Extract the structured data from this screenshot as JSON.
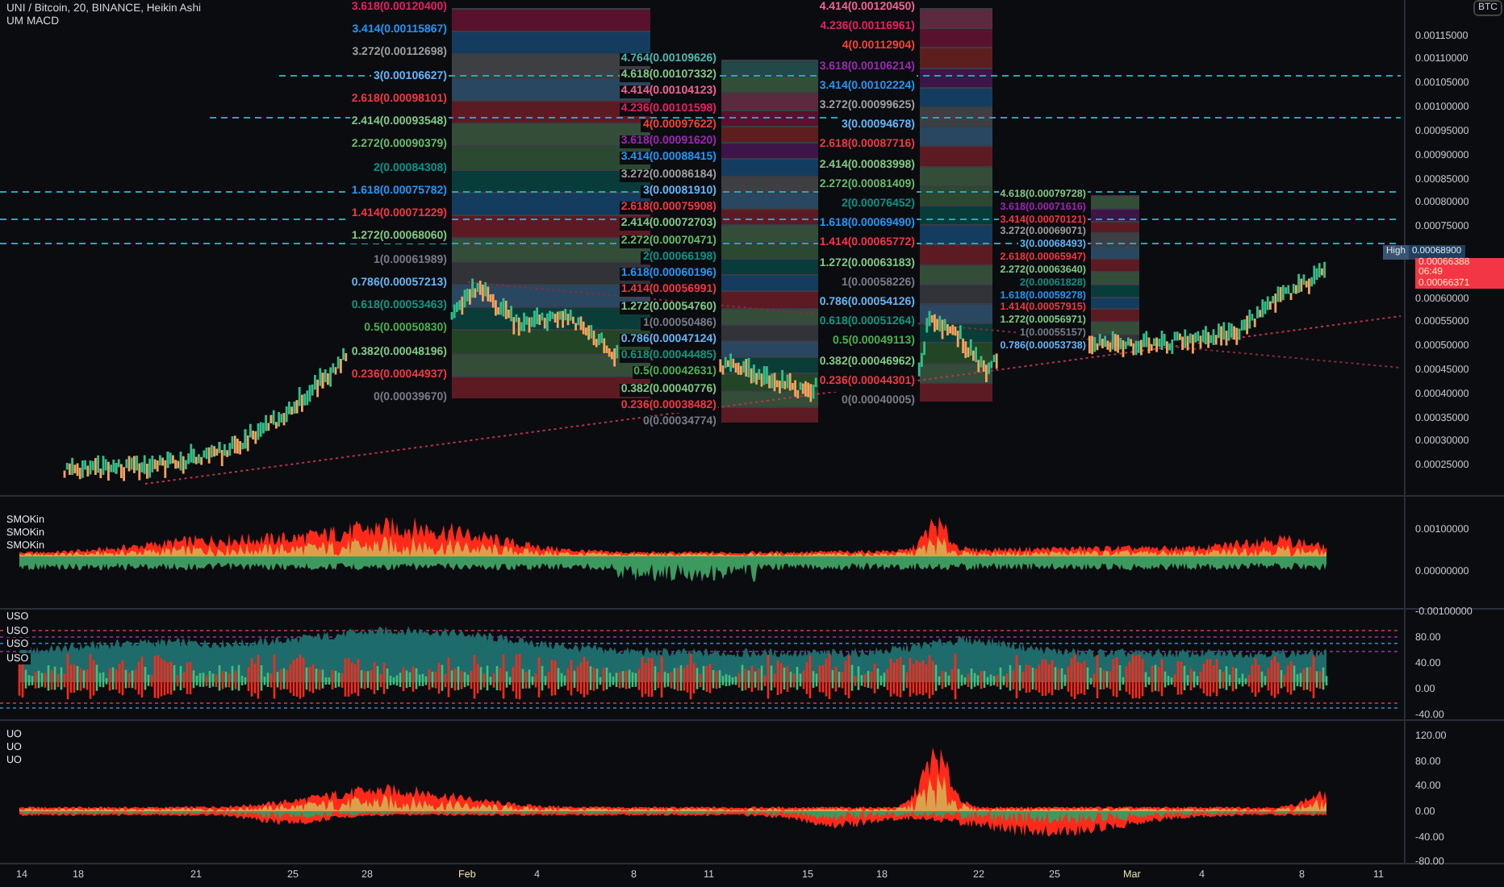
{
  "header": {
    "symbol": "UNI / Bitcoin, 20, BINANCE, Heikin Ashi",
    "indicator": "UM MACD"
  },
  "price_axis": {
    "unit": "BTC",
    "ticks_upper": [
      "0.00115000",
      "0.00110000",
      "0.00105000",
      "0.00100000",
      "0.00095000",
      "0.00090000",
      "0.00085000",
      "0.00080000",
      "0.00075000"
    ],
    "ticks_lower": [
      "0.00060000",
      "0.00055000",
      "0.00050000",
      "0.00045000",
      "0.00040000",
      "0.00035000",
      "0.00030000",
      "0.00025000"
    ],
    "high": {
      "label": "High",
      "value": "0.00068900"
    },
    "last": {
      "value": "0.00066388",
      "countdown": "06:49",
      "prev": "0.00066371"
    }
  },
  "fib_blocks": [
    {
      "levels": [
        {
          "label": "3.618(0.00120400)",
          "color": "#e91e63"
        },
        {
          "label": "3.414(0.00115867)",
          "color": "#2196f3"
        },
        {
          "label": "3.272(0.00112698)",
          "color": "#9e9e9e"
        },
        {
          "label": "3(0.00106627)",
          "color": "#64b5f6"
        },
        {
          "label": "2.618(0.00098101)",
          "color": "#f23645"
        },
        {
          "label": "2.414(0.00093548)",
          "color": "#81c784"
        },
        {
          "label": "2.272(0.00090379)",
          "color": "#66bb6a"
        },
        {
          "label": "2(0.00084308)",
          "color": "#009688"
        },
        {
          "label": "1.618(0.00075782)",
          "color": "#2196f3"
        },
        {
          "label": "1.414(0.00071229)",
          "color": "#f23645"
        },
        {
          "label": "1.272(0.00068060)",
          "color": "#81c784"
        },
        {
          "label": "1(0.00061989)",
          "color": "#787b86"
        },
        {
          "label": "0.786(0.00057213)",
          "color": "#64b5f6"
        },
        {
          "label": "0.618(0.00053463)",
          "color": "#089981"
        },
        {
          "label": "0.5(0.00050830)",
          "color": "#4caf50"
        },
        {
          "label": "0.382(0.00048196)",
          "color": "#81c784"
        },
        {
          "label": "0.236(0.00044937)",
          "color": "#f23645"
        },
        {
          "label": "0(0.00039670)",
          "color": "#787b86"
        }
      ]
    },
    {
      "levels": [
        {
          "label": "4.764(0.00109626)",
          "color": "#4db6ac"
        },
        {
          "label": "4.618(0.00107332)",
          "color": "#81c784"
        },
        {
          "label": "4.414(0.00104123)",
          "color": "#f06292"
        },
        {
          "label": "4.236(0.00101598)",
          "color": "#e91e63"
        },
        {
          "label": "4(0.00097622)",
          "color": "#f44336"
        },
        {
          "label": "3.618(0.00091620)",
          "color": "#9c27b0"
        },
        {
          "label": "3.414(0.00088415)",
          "color": "#2196f3"
        },
        {
          "label": "3.272(0.00086184)",
          "color": "#9e9e9e"
        },
        {
          "label": "3(0.00081910)",
          "color": "#64b5f6"
        },
        {
          "label": "2.618(0.00075908)",
          "color": "#f23645"
        },
        {
          "label": "2.414(0.00072703)",
          "color": "#81c784"
        },
        {
          "label": "2.272(0.00070471)",
          "color": "#66bb6a"
        },
        {
          "label": "2(0.00066198)",
          "color": "#009688"
        },
        {
          "label": "1.618(0.00060196)",
          "color": "#2196f3"
        },
        {
          "label": "1.414(0.00056991)",
          "color": "#f23645"
        },
        {
          "label": "1.272(0.00054760)",
          "color": "#81c784"
        },
        {
          "label": "1(0.00050486)",
          "color": "#787b86"
        },
        {
          "label": "0.786(0.00047124)",
          "color": "#64b5f6"
        },
        {
          "label": "0.618(0.00044485)",
          "color": "#089981"
        },
        {
          "label": "0.5(0.00042631)",
          "color": "#4caf50"
        },
        {
          "label": "0.382(0.00040776)",
          "color": "#81c784"
        },
        {
          "label": "0.236(0.00038482)",
          "color": "#f23645"
        },
        {
          "label": "0(0.00034774)",
          "color": "#787b86"
        }
      ]
    },
    {
      "levels": [
        {
          "label": "4.414(0.00120450)",
          "color": "#f06292"
        },
        {
          "label": "4.236(0.00116961)",
          "color": "#e91e63"
        },
        {
          "label": "4(0.00112904)",
          "color": "#f44336"
        },
        {
          "label": "3.618(0.00106214)",
          "color": "#9c27b0"
        },
        {
          "label": "3.414(0.00102224)",
          "color": "#2196f3"
        },
        {
          "label": "3.272(0.00099625)",
          "color": "#9e9e9e"
        },
        {
          "label": "3(0.00094678)",
          "color": "#64b5f6"
        },
        {
          "label": "2.618(0.00087716)",
          "color": "#f23645"
        },
        {
          "label": "2.414(0.00083998)",
          "color": "#81c784"
        },
        {
          "label": "2.272(0.00081409)",
          "color": "#66bb6a"
        },
        {
          "label": "2(0.00076452)",
          "color": "#009688"
        },
        {
          "label": "1.618(0.00069490)",
          "color": "#2196f3"
        },
        {
          "label": "1.414(0.00065772)",
          "color": "#f23645"
        },
        {
          "label": "1.272(0.00063183)",
          "color": "#81c784"
        },
        {
          "label": "1(0.00058226)",
          "color": "#787b86"
        },
        {
          "label": "0.786(0.00054126)",
          "color": "#64b5f6"
        },
        {
          "label": "0.618(0.00051264)",
          "color": "#089981"
        },
        {
          "label": "0.5(0.00049113)",
          "color": "#4caf50"
        },
        {
          "label": "0.382(0.00046962)",
          "color": "#81c784"
        },
        {
          "label": "0.236(0.00044301)",
          "color": "#f23645"
        },
        {
          "label": "0(0.00040005)",
          "color": "#787b86"
        }
      ]
    },
    {
      "levels": [
        {
          "label": "4.618(0.00079728)",
          "color": "#81c784"
        },
        {
          "label": "3.618(0.00071616)",
          "color": "#9c27b0"
        },
        {
          "label": "3.414(0.00070121)",
          "color": "#f23645"
        },
        {
          "label": "3.272(0.00069071)",
          "color": "#9e9e9e"
        },
        {
          "label": "3(0.00068493)",
          "color": "#64b5f6"
        },
        {
          "label": "2.618(0.00065947)",
          "color": "#f23645"
        },
        {
          "label": "2.272(0.00063640)",
          "color": "#81c784"
        },
        {
          "label": "2(0.00061828)",
          "color": "#009688"
        },
        {
          "label": "1.618(0.00059278)",
          "color": "#2196f3"
        },
        {
          "label": "1.414(0.00057915)",
          "color": "#f23645"
        },
        {
          "label": "1.272(0.00056971)",
          "color": "#81c784"
        },
        {
          "label": "1(0.00055157)",
          "color": "#787b86"
        },
        {
          "label": "0.786(0.00053738)",
          "color": "#64b5f6"
        }
      ]
    }
  ],
  "panes": [
    {
      "kind": "histogram",
      "labels": [
        "SMOKin",
        "SMOKin",
        "SMOKin"
      ],
      "ticks": [
        "0.00100000",
        "0.00000000",
        "-0.00100000"
      ]
    },
    {
      "kind": "stacked",
      "labels": [
        "USO",
        "USO",
        "USO",
        "USO"
      ],
      "ticks": [
        "80.00",
        "40.00",
        "0.00",
        "-40.00"
      ]
    },
    {
      "kind": "oscillator",
      "labels": [
        "UO",
        "UO",
        "UO"
      ],
      "ticks": [
        "120.00",
        "80.00",
        "40.00",
        "0.00",
        "-40.00",
        "-80.00"
      ]
    }
  ],
  "time_axis": [
    "14",
    "18",
    "21",
    "25",
    "28",
    "Feb",
    "4",
    "8",
    "11",
    "15",
    "18",
    "22",
    "25",
    "Mar",
    "4",
    "8",
    "11"
  ]
}
